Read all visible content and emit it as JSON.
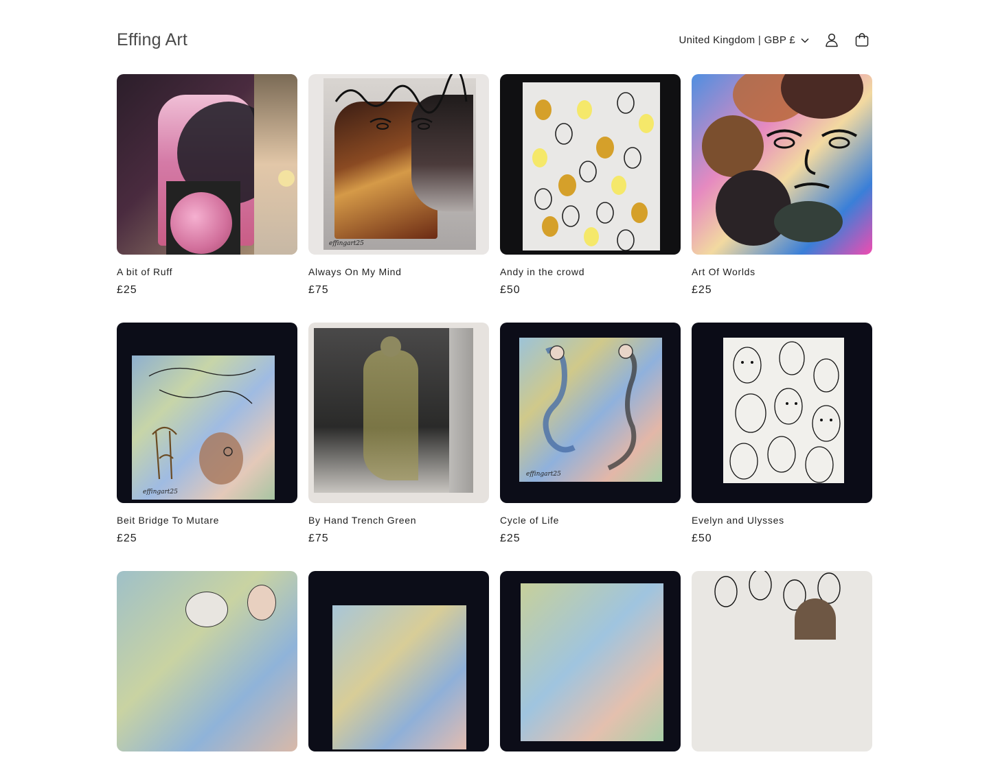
{
  "header": {
    "brand": "Effing Art",
    "locale": "United Kingdom | GBP £",
    "icons": [
      "chevron-down-icon",
      "account-icon",
      "cart-icon"
    ]
  },
  "products": [
    {
      "title": "A bit of Ruff",
      "price": "£25"
    },
    {
      "title": "Always On My Mind",
      "price": "£75"
    },
    {
      "title": "Andy in the crowd",
      "price": "£50"
    },
    {
      "title": "Art Of Worlds",
      "price": "£25"
    },
    {
      "title": "Beit Bridge To Mutare",
      "price": "£25"
    },
    {
      "title": "By Hand Trench Green",
      "price": "£75"
    },
    {
      "title": "Cycle of Life",
      "price": "£25"
    },
    {
      "title": "Evelyn and Ulysses",
      "price": "£50"
    },
    {
      "title": "",
      "price": ""
    },
    {
      "title": "",
      "price": ""
    },
    {
      "title": "",
      "price": ""
    },
    {
      "title": "",
      "price": ""
    }
  ],
  "artwork_signatures": [
    "effingart25",
    "effingart25",
    "effingart25",
    "effingart25"
  ]
}
